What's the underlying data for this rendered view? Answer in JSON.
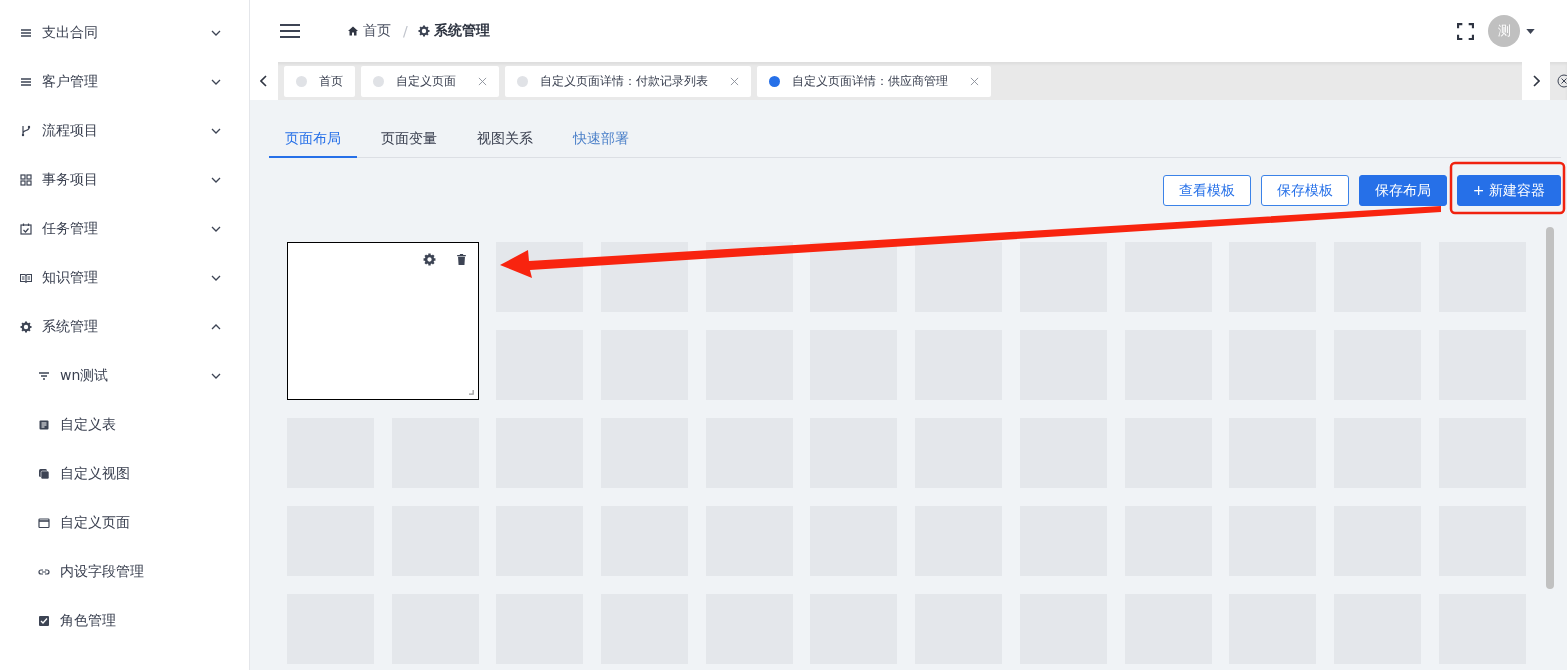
{
  "sidebar": {
    "items": [
      {
        "label": "支出合同",
        "kind": "lines",
        "expanded": false
      },
      {
        "label": "客户管理",
        "kind": "lines",
        "expanded": false
      },
      {
        "label": "流程项目",
        "kind": "branch",
        "expanded": false
      },
      {
        "label": "事务项目",
        "kind": "grid",
        "expanded": false
      },
      {
        "label": "任务管理",
        "kind": "calendar",
        "expanded": false
      },
      {
        "label": "知识管理",
        "kind": "book",
        "expanded": false
      },
      {
        "label": "系统管理",
        "kind": "gear",
        "expanded": true,
        "children": [
          {
            "label": "wn测试",
            "kind": "filter",
            "expanded": false
          },
          {
            "label": "自定义表",
            "kind": "doc"
          },
          {
            "label": "自定义视图",
            "kind": "stack"
          },
          {
            "label": "自定义页面",
            "kind": "window"
          },
          {
            "label": "内设字段管理",
            "kind": "link"
          },
          {
            "label": "角色管理",
            "kind": "check"
          }
        ]
      }
    ]
  },
  "header": {
    "breadcrumb": [
      {
        "label": "首页",
        "kind": "home",
        "current": false
      },
      {
        "label": "系统管理",
        "kind": "gear",
        "current": true
      }
    ],
    "separator": "/",
    "avatar": "测"
  },
  "page_tabs": [
    {
      "label": "首页",
      "selected": false,
      "closable": false
    },
    {
      "label": "自定义页面",
      "selected": false,
      "closable": true
    },
    {
      "label": "自定义页面详情：付款记录列表",
      "selected": false,
      "closable": true
    },
    {
      "label": "自定义页面详情：供应商管理",
      "selected": true,
      "closable": true
    }
  ],
  "sub_tabs": [
    {
      "label": "页面布局",
      "selected": true,
      "hovered": false
    },
    {
      "label": "页面变量",
      "selected": false,
      "hovered": false
    },
    {
      "label": "视图关系",
      "selected": false,
      "hovered": false
    },
    {
      "label": "快速部署",
      "selected": false,
      "hovered": true
    }
  ],
  "buttons": [
    {
      "label": "查看模板",
      "kind": "outline"
    },
    {
      "label": "保存模板",
      "kind": "outline"
    },
    {
      "label": "保存布局",
      "kind": "primary"
    },
    {
      "label": "+ 新建容器",
      "kind": "primary"
    }
  ],
  "canvas": {
    "containers": [
      {
        "kind": "box"
      }
    ]
  }
}
